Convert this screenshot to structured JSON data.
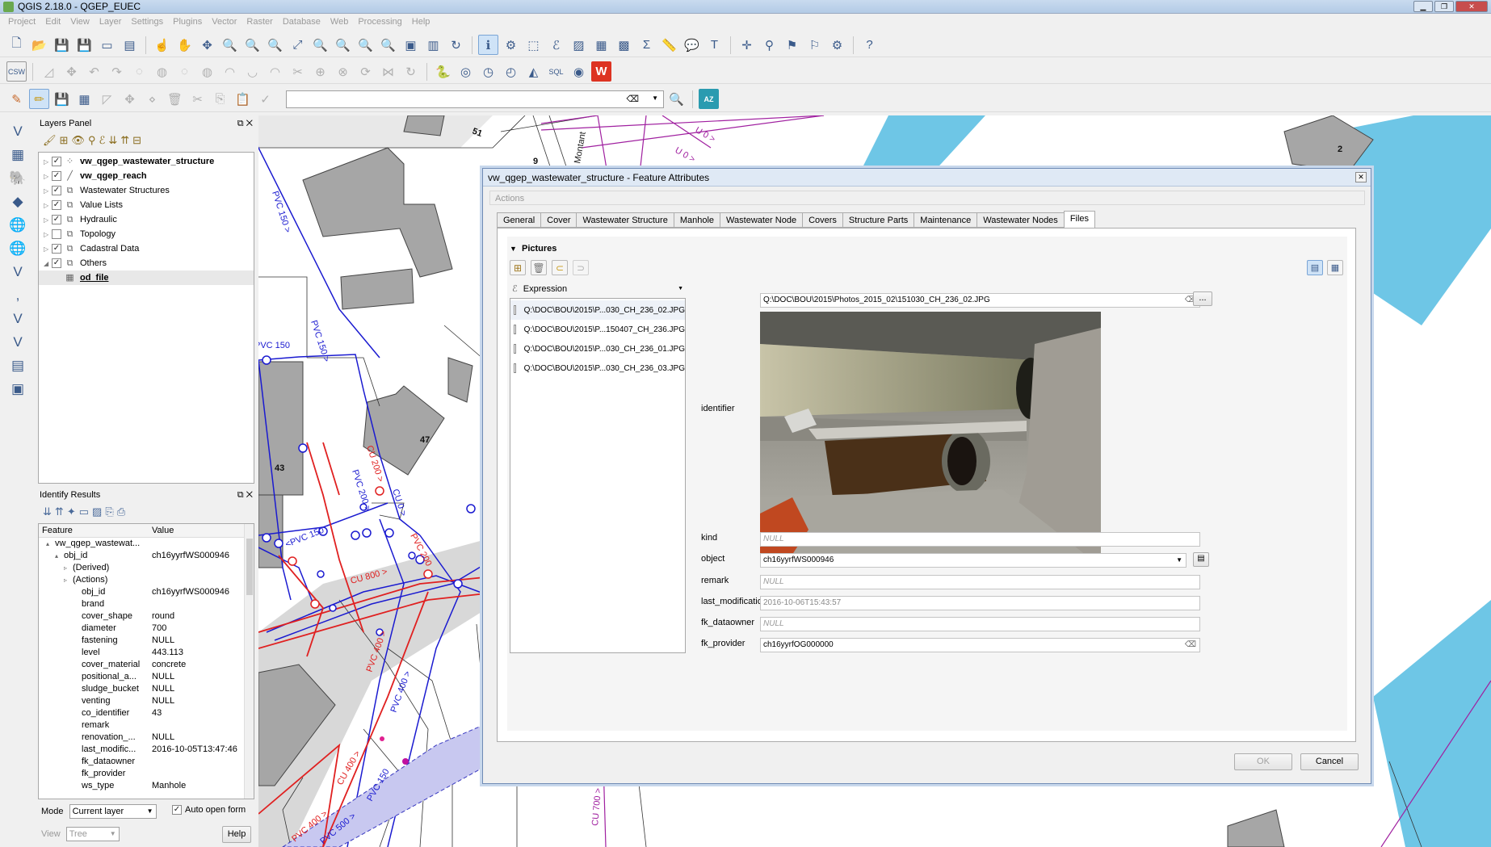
{
  "window": {
    "title": "QGIS 2.18.0 - QGEP_EUEC"
  },
  "menu": [
    "Project",
    "Edit",
    "View",
    "Layer",
    "Settings",
    "Plugins",
    "Vector",
    "Raster",
    "Database",
    "Web",
    "Processing",
    "Help"
  ],
  "toolbar3": {
    "az_label": "AZ"
  },
  "layers_panel": {
    "title": "Layers Panel",
    "layers": [
      {
        "name": "vw_qgep_wastewater_structure",
        "checked": true,
        "bold": true,
        "icon": "point-layer-icon",
        "expanded": false
      },
      {
        "name": "vw_qgep_reach",
        "checked": true,
        "bold": true,
        "icon": "line-layer-icon",
        "expanded": false
      },
      {
        "name": "Wastewater Structures",
        "checked": true,
        "bold": false,
        "icon": "group-icon",
        "expanded": false
      },
      {
        "name": "Value Lists",
        "checked": true,
        "bold": false,
        "icon": "group-icon",
        "expanded": false
      },
      {
        "name": "Hydraulic",
        "checked": true,
        "bold": false,
        "icon": "group-icon",
        "expanded": false
      },
      {
        "name": "Topology",
        "checked": false,
        "bold": false,
        "icon": "group-icon",
        "expanded": false
      },
      {
        "name": "Cadastral Data",
        "checked": true,
        "bold": false,
        "icon": "group-icon",
        "expanded": false
      },
      {
        "name": "Others",
        "checked": true,
        "bold": false,
        "icon": "group-icon",
        "expanded": true
      },
      {
        "name": "od_file",
        "checked": null,
        "bold": true,
        "icon": "table-icon",
        "expanded": false,
        "child": true
      }
    ]
  },
  "identify": {
    "title": "Identify Results",
    "col_feature": "Feature",
    "col_value": "Value",
    "rows": [
      {
        "k": "vw_qgep_wastewat...",
        "v": "",
        "indent": 1,
        "arrow": "▴"
      },
      {
        "k": "obj_id",
        "v": "ch16yyrfWS000946",
        "indent": 2,
        "arrow": "▴"
      },
      {
        "k": "(Derived)",
        "v": "",
        "indent": 3,
        "arrow": "▹"
      },
      {
        "k": "(Actions)",
        "v": "",
        "indent": 3,
        "arrow": "▹"
      },
      {
        "k": "obj_id",
        "v": "ch16yyrfWS000946",
        "indent": 4,
        "arrow": ""
      },
      {
        "k": "brand",
        "v": "",
        "indent": 4,
        "arrow": ""
      },
      {
        "k": "cover_shape",
        "v": "round",
        "indent": 4,
        "arrow": ""
      },
      {
        "k": "diameter",
        "v": "700",
        "indent": 4,
        "arrow": ""
      },
      {
        "k": "fastening",
        "v": "NULL",
        "indent": 4,
        "arrow": ""
      },
      {
        "k": "level",
        "v": "443.113",
        "indent": 4,
        "arrow": ""
      },
      {
        "k": "cover_material",
        "v": "concrete",
        "indent": 4,
        "arrow": ""
      },
      {
        "k": "positional_a...",
        "v": "NULL",
        "indent": 4,
        "arrow": ""
      },
      {
        "k": "sludge_bucket",
        "v": "NULL",
        "indent": 4,
        "arrow": ""
      },
      {
        "k": "venting",
        "v": "NULL",
        "indent": 4,
        "arrow": ""
      },
      {
        "k": "co_identifier",
        "v": "43",
        "indent": 4,
        "arrow": ""
      },
      {
        "k": "remark",
        "v": "",
        "indent": 4,
        "arrow": ""
      },
      {
        "k": "renovation_...",
        "v": "NULL",
        "indent": 4,
        "arrow": ""
      },
      {
        "k": "last_modific...",
        "v": "2016-10-05T13:47:46",
        "indent": 4,
        "arrow": ""
      },
      {
        "k": "fk_dataowner",
        "v": "",
        "indent": 4,
        "arrow": ""
      },
      {
        "k": "fk_provider",
        "v": "",
        "indent": 4,
        "arrow": ""
      },
      {
        "k": "ws_type",
        "v": "Manhole",
        "indent": 4,
        "arrow": ""
      }
    ],
    "mode_label": "Mode",
    "mode_value": "Current layer",
    "auto_open_label": "Auto open form",
    "view_label": "View",
    "view_value": "Tree",
    "help_label": "Help"
  },
  "map_labels": {
    "pvc150_a": "PVC 150 >",
    "pvc150_b": "PVC 150",
    "pvc150_c": "PVC 150 >",
    "pvc200": "PVC 200 >",
    "cu200": "CU 200 >",
    "cu0": "CU 0 >",
    "pvc150_d": "<PVC 150",
    "pvc200_b": "PVC 200",
    "cu800": "CU 800 >",
    "pvc400": "PVC 400 >",
    "pvc400_b": "PVC 400 >",
    "cu400": "CU 400 >",
    "pvc400_c": "PVC 400 >",
    "pvc500": "PVC 500 >",
    "pvc150_e": "PVC 150",
    "cu700": "CU 700 >",
    "u0": "U 0 >",
    "u0b": "U 0 >",
    "montant": "Montant",
    "n51": "51",
    "n47": "47",
    "n43": "43",
    "n9": "9",
    "n2": "2"
  },
  "dialog": {
    "title": "vw_qgep_wastewater_structure - Feature Attributes",
    "actions_label": "Actions",
    "tabs": [
      "General",
      "Cover",
      "Wastewater Structure",
      "Manhole",
      "Wastewater Node",
      "Covers",
      "Structure Parts",
      "Maintenance",
      "Wastewater Nodes",
      "Files"
    ],
    "active_tab": "Files",
    "group_title": "Pictures",
    "expression_label": "Expression",
    "files": [
      "Q:\\DOC\\BOU\\2015\\P...030_CH_236_02.JPG",
      "Q:\\DOC\\BOU\\2015\\P...150407_CH_236.JPG",
      "Q:\\DOC\\BOU\\2015\\P...030_CH_236_01.JPG",
      "Q:\\DOC\\BOU\\2015\\P...030_CH_236_03.JPG"
    ],
    "fields": {
      "identifier_label": "identifier",
      "identifier_path": "Q:\\DOC\\BOU\\2015\\Photos_2015_02\\151030_CH_236_02.JPG",
      "browse_label": "...",
      "kind_label": "kind",
      "kind_value": "NULL",
      "object_label": "object",
      "object_value": "ch16yyrfWS000946",
      "remark_label": "remark",
      "remark_value": "NULL",
      "last_modification_label": "last_modification",
      "last_modification_value": "2016-10-06T15:43:57",
      "fk_dataowner_label": "fk_dataowner",
      "fk_dataowner_value": "NULL",
      "fk_provider_label": "fk_provider",
      "fk_provider_value": "ch16yyrfOG000000"
    },
    "ok_label": "OK",
    "cancel_label": "Cancel"
  }
}
